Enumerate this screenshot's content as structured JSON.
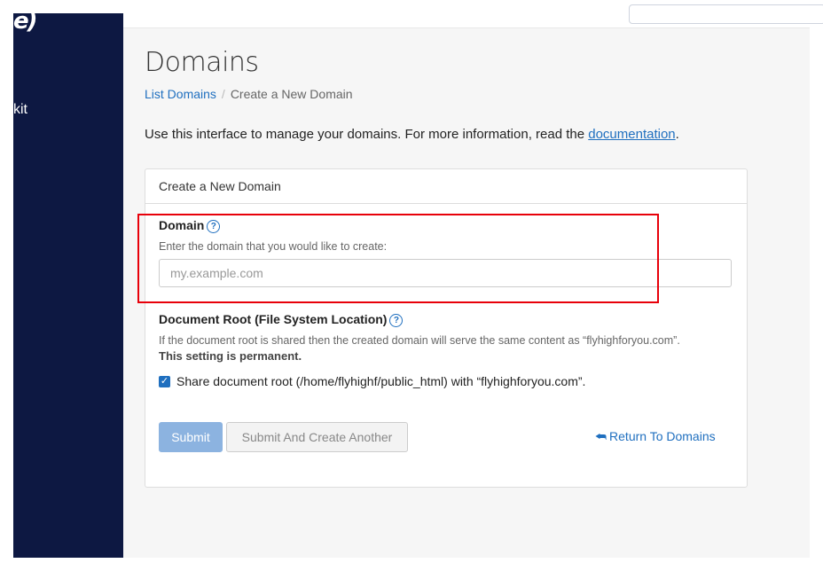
{
  "sidebar": {
    "logo_fragment": "e)",
    "item_fragment": "kit"
  },
  "page": {
    "title": "Domains",
    "breadcrumb": {
      "link": "List Domains",
      "separator": "/",
      "current": "Create a New Domain"
    },
    "intro_text": "Use this interface to manage your domains. For more information, read the ",
    "intro_link": "documentation",
    "intro_end": "."
  },
  "form": {
    "panel_title": "Create a New Domain",
    "domain_label": "Domain",
    "domain_hint": "Enter the domain that you would like to create:",
    "domain_placeholder": "my.example.com",
    "domain_value": "",
    "docroot_label": "Document Root (File System Location)",
    "docroot_hint": "If the document root is shared then the created domain will serve the same content as “flyhighforyou.com”.",
    "docroot_permanent": "This setting is permanent.",
    "share_checked": true,
    "share_label": "Share document root (/home/flyhighf/public_html) with “flyhighforyou.com”.",
    "submit_label": "Submit",
    "submit_another_label": "Submit And Create Another",
    "return_label": "Return To Domains"
  },
  "icons": {
    "help": "question-circle-icon",
    "return": "reply-arrow-icon",
    "check": "checkmark-icon"
  },
  "colors": {
    "sidebar": "#0d1842",
    "link": "#1f6fbf",
    "highlight": "#e8000a",
    "submit": "#8cb3e0"
  }
}
